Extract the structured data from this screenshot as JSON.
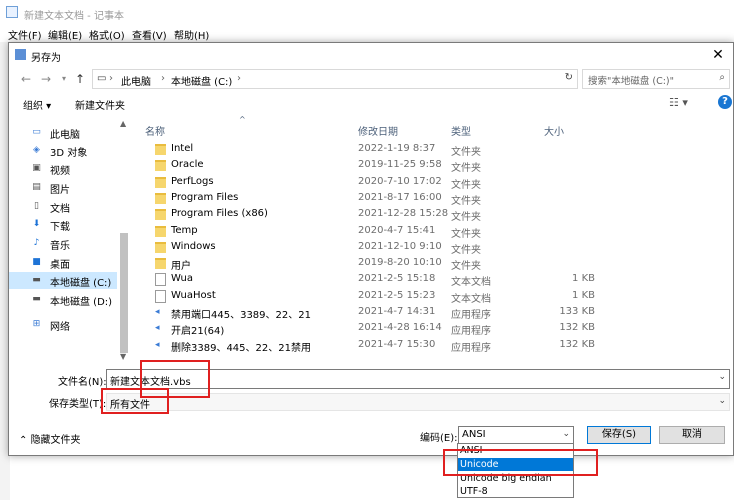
{
  "notepad": {
    "title": "新建文本文档 - 记事本",
    "menu": [
      "文件(F)",
      "编辑(E)",
      "格式(O)",
      "查看(V)",
      "帮助(H)"
    ]
  },
  "dialog": {
    "title": "另存为",
    "address": {
      "root": "此电脑",
      "drive": "本地磁盘 (C:)"
    },
    "search_placeholder": "搜索\"本地磁盘 (C:)\"",
    "toolbar": {
      "organize": "组织 ▾",
      "new_folder": "新建文件夹",
      "help": "?"
    },
    "nav": [
      "此电脑",
      "3D 对象",
      "视频",
      "图片",
      "文档",
      "下载",
      "音乐",
      "桌面",
      "本地磁盘 (C:)",
      "本地磁盘 (D:)",
      "网络"
    ],
    "columns": {
      "name": "名称",
      "date": "修改日期",
      "type": "类型",
      "size": "大小"
    },
    "files": [
      {
        "name": "Intel",
        "date": "2022-1-19 8:37",
        "type": "文件夹",
        "size": "",
        "icon": "folder"
      },
      {
        "name": "Oracle",
        "date": "2019-11-25 9:58",
        "type": "文件夹",
        "size": "",
        "icon": "folder"
      },
      {
        "name": "PerfLogs",
        "date": "2020-7-10 17:02",
        "type": "文件夹",
        "size": "",
        "icon": "folder"
      },
      {
        "name": "Program Files",
        "date": "2021-8-17 16:00",
        "type": "文件夹",
        "size": "",
        "icon": "folder"
      },
      {
        "name": "Program Files (x86)",
        "date": "2021-12-28 15:28",
        "type": "文件夹",
        "size": "",
        "icon": "folder"
      },
      {
        "name": "Temp",
        "date": "2020-4-7 15:41",
        "type": "文件夹",
        "size": "",
        "icon": "folder"
      },
      {
        "name": "Windows",
        "date": "2021-12-10 9:10",
        "type": "文件夹",
        "size": "",
        "icon": "folder"
      },
      {
        "name": "用户",
        "date": "2019-8-20 10:10",
        "type": "文件夹",
        "size": "",
        "icon": "folder"
      },
      {
        "name": "Wua",
        "date": "2021-2-5 15:18",
        "type": "文本文档",
        "size": "1 KB",
        "icon": "txt"
      },
      {
        "name": "WuaHost",
        "date": "2021-2-5 15:23",
        "type": "文本文档",
        "size": "1 KB",
        "icon": "txt"
      },
      {
        "name": "禁用端口445、3389、22、21",
        "date": "2021-4-7 14:31",
        "type": "应用程序",
        "size": "133 KB",
        "icon": "app"
      },
      {
        "name": "开启21(64)",
        "date": "2021-4-28 16:14",
        "type": "应用程序",
        "size": "132 KB",
        "icon": "app"
      },
      {
        "name": "删除3389、445、22、21禁用",
        "date": "2021-4-7 15:30",
        "type": "应用程序",
        "size": "132 KB",
        "icon": "app"
      }
    ],
    "filename_label": "文件名(N):",
    "filename_value": "新建文本文档.vbs",
    "filetype_label": "保存类型(T):",
    "filetype_value": "所有文件",
    "hide_folders": "隐藏文件夹",
    "encoding_label": "编码(E):",
    "encoding_value": "ANSI",
    "encoding_options": [
      "ANSI",
      "Unicode",
      "Unicode big endian",
      "UTF-8"
    ],
    "encoding_selected": "Unicode",
    "save_button": "保存(S)",
    "cancel_button": "取消"
  },
  "colors": {
    "accent": "#0078d7",
    "highlight_box": "#e02020",
    "selection": "#cce8ff"
  }
}
